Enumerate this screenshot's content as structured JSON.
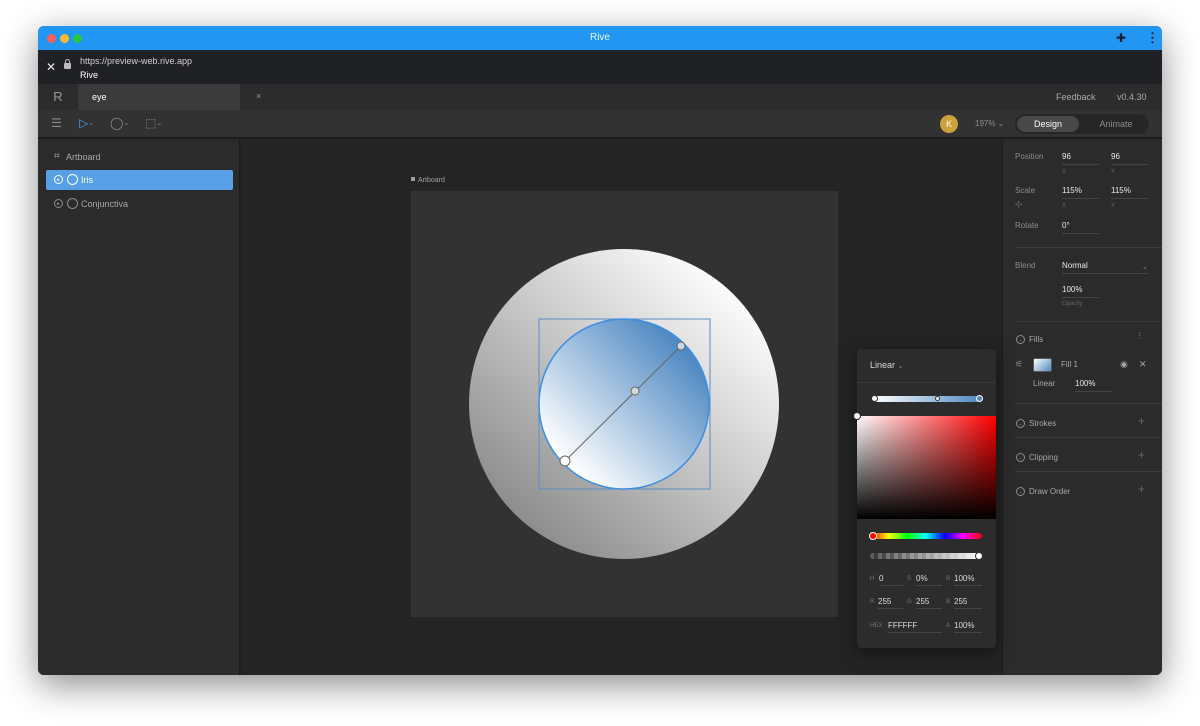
{
  "window": {
    "title": "Rive"
  },
  "browser": {
    "url": "https://preview-web.rive.app",
    "site_name": "Rive"
  },
  "tabs": {
    "logo": "R",
    "active_tab": "eye",
    "close": "×",
    "feedback": "Feedback",
    "version": "v0.4.30"
  },
  "toolbar": {
    "avatar_initial": "K",
    "zoom": "197% ⌄",
    "mode_design": "Design",
    "mode_animate": "Animate"
  },
  "hierarchy": {
    "items": [
      {
        "label": "Artboard"
      },
      {
        "label": "Iris",
        "selected": true
      },
      {
        "label": "Conjunctiva"
      }
    ]
  },
  "canvas": {
    "artboard_label": "Artboard"
  },
  "picker": {
    "type": "Linear",
    "h_label": "H",
    "h": "0",
    "s_label": "S",
    "s": "0%",
    "b_label": "B",
    "b": "100%",
    "r_label": "R",
    "r": "255",
    "g_label": "G",
    "g": "255",
    "b2_label": "B",
    "b2": "255",
    "hex_label": "HEX",
    "hex": "FFFFFF",
    "a_label": "A",
    "a": "100%"
  },
  "inspector": {
    "position_label": "Position",
    "position_x": "96",
    "position_y": "96",
    "scale_label": "Scale",
    "scale_x": "115%",
    "scale_y": "115%",
    "rotate_label": "Rotate",
    "rotate": "0°",
    "x_label": "X",
    "y_label": "Y",
    "blend_label": "Blend",
    "blend": "Normal",
    "opacity": "100%",
    "opacity_label": "Opacity",
    "fills_label": "Fills",
    "fill_name": "Fill 1",
    "fill_type": "Linear",
    "fill_opacity": "100%",
    "strokes_label": "Strokes",
    "clipping_label": "Clipping",
    "draw_order_label": "Draw Order"
  },
  "colors": {
    "accent": "#2196f3",
    "selection": "#57a0e5",
    "gradient_end": "#4f89c2"
  }
}
